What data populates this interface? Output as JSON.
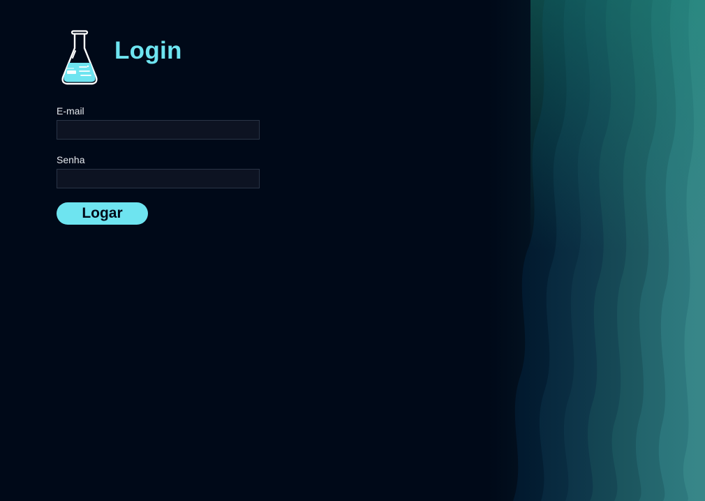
{
  "header": {
    "title": "Login",
    "logo_icon": "flask-icon"
  },
  "form": {
    "email": {
      "label": "E-mail",
      "value": "",
      "placeholder": ""
    },
    "password": {
      "label": "Senha",
      "value": "",
      "placeholder": ""
    },
    "submit_label": "Logar"
  },
  "colors": {
    "background": "#000918",
    "accent": "#6ee4f0",
    "input_background": "#0d1322",
    "input_border": "#2a3446",
    "label_text": "#e6e9ee",
    "wave_teal": "#1f7f86"
  }
}
